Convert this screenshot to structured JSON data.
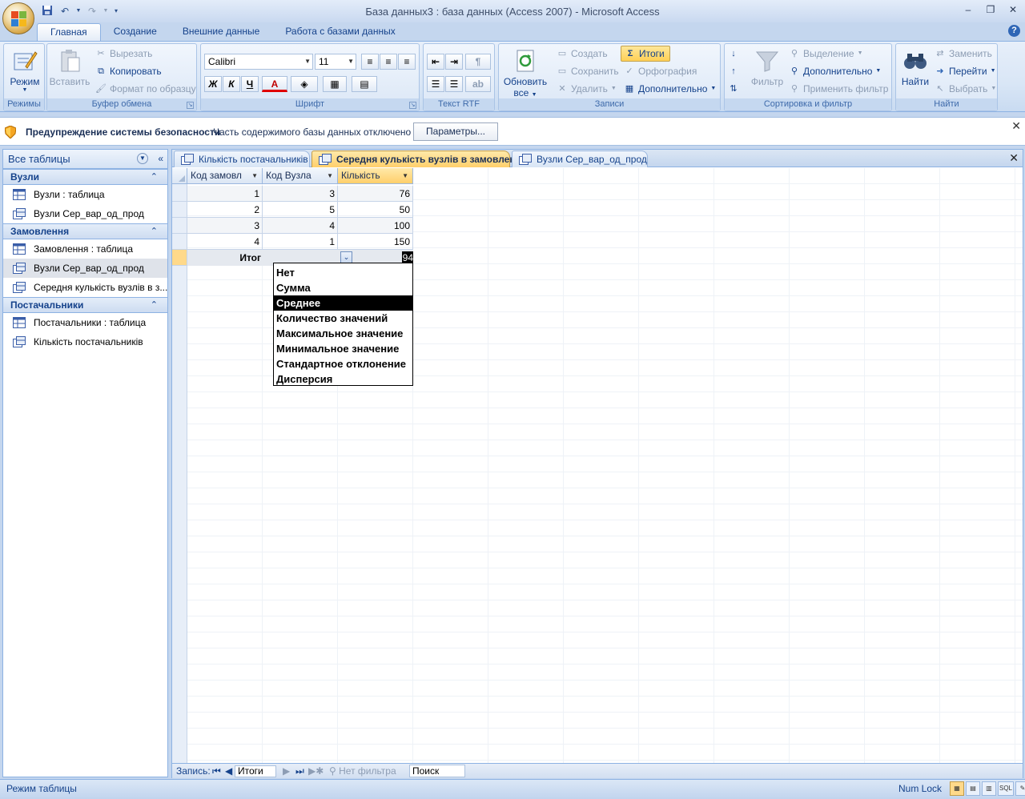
{
  "window": {
    "title": "База данных3 : база данных (Access 2007) - Microsoft Access"
  },
  "ribbon_tabs": [
    {
      "label": "Главная",
      "active": true
    },
    {
      "label": "Создание",
      "active": false
    },
    {
      "label": "Внешние данные",
      "active": false
    },
    {
      "label": "Работа с базами данных",
      "active": false
    }
  ],
  "ribbon": {
    "modes": {
      "label": "Режимы",
      "view_btn": "Режим"
    },
    "clipboard": {
      "label": "Буфер обмена",
      "paste": "Вставить",
      "cut": "Вырезать",
      "copy": "Копировать",
      "format_painter": "Формат по образцу"
    },
    "font": {
      "label": "Шрифт",
      "font_name": "Calibri",
      "font_size": "11",
      "bold": "Ж",
      "italic": "К",
      "underline": "Ч",
      "font_color": "A"
    },
    "rtf": {
      "label": "Текст RTF"
    },
    "records": {
      "label": "Записи",
      "refresh": "Обновить",
      "refresh2": "все",
      "new": "Создать",
      "save": "Сохранить",
      "delete": "Удалить",
      "totals": "Итоги",
      "spelling": "Орфография",
      "more": "Дополнительно"
    },
    "sort_filter": {
      "label": "Сортировка и фильтр",
      "filter": "Фильтр",
      "selection": "Выделение",
      "advanced": "Дополнительно",
      "toggle_filter": "Применить фильтр"
    },
    "find": {
      "label": "Найти",
      "find_btn": "Найти",
      "replace": "Заменить",
      "goto": "Перейти",
      "select": "Выбрать"
    }
  },
  "security_bar": {
    "title": "Предупреждение системы безопасности",
    "message": "Часть содержимого базы данных отключено",
    "options_button": "Параметры..."
  },
  "nav_pane": {
    "header": "Все таблицы",
    "groups": [
      {
        "name": "Вузли",
        "items": [
          {
            "label": "Вузли : таблица",
            "type": "table"
          },
          {
            "label": "Вузли Сер_вар_од_прод",
            "type": "query"
          }
        ]
      },
      {
        "name": "Замовлення",
        "items": [
          {
            "label": "Замовлення : таблица",
            "type": "table"
          },
          {
            "label": "Вузли Сер_вар_од_прод",
            "type": "query",
            "selected": true
          },
          {
            "label": "Середня кулькість вузлів в з...",
            "type": "query"
          }
        ]
      },
      {
        "name": "Постачальники",
        "items": [
          {
            "label": "Постачальники : таблица",
            "type": "table"
          },
          {
            "label": "Кількість постачальників",
            "type": "query"
          }
        ]
      }
    ]
  },
  "doc_tabs": [
    {
      "label": "Кількість постачальників",
      "active": false
    },
    {
      "label": "Середня кулькість вузлів в замовленях",
      "active": true
    },
    {
      "label": "Вузли Сер_вар_од_прод",
      "active": false
    }
  ],
  "datasheet": {
    "columns": [
      "Код замовл",
      "Код Вузла",
      "Кількість"
    ],
    "rows": [
      [
        "1",
        "3",
        "76"
      ],
      [
        "2",
        "5",
        "50"
      ],
      [
        "3",
        "4",
        "100"
      ],
      [
        "4",
        "1",
        "150"
      ]
    ],
    "total_label": "Итог",
    "total_value": "94"
  },
  "totals_dropdown": {
    "options": [
      "Нет",
      "Сумма",
      "Среднее",
      "Количество значений",
      "Максимальное значение",
      "Минимальное значение",
      "Стандартное отклонение",
      "Дисперсия"
    ],
    "selected": "Среднее"
  },
  "record_nav": {
    "label": "Запись:",
    "current": "Итоги",
    "filter": "Нет фильтра",
    "search": "Поиск"
  },
  "status_bar": {
    "mode": "Режим таблицы",
    "numlock": "Num Lock"
  },
  "colors": {
    "accent": "#15428b",
    "active_tab": "#ffcf6b"
  }
}
